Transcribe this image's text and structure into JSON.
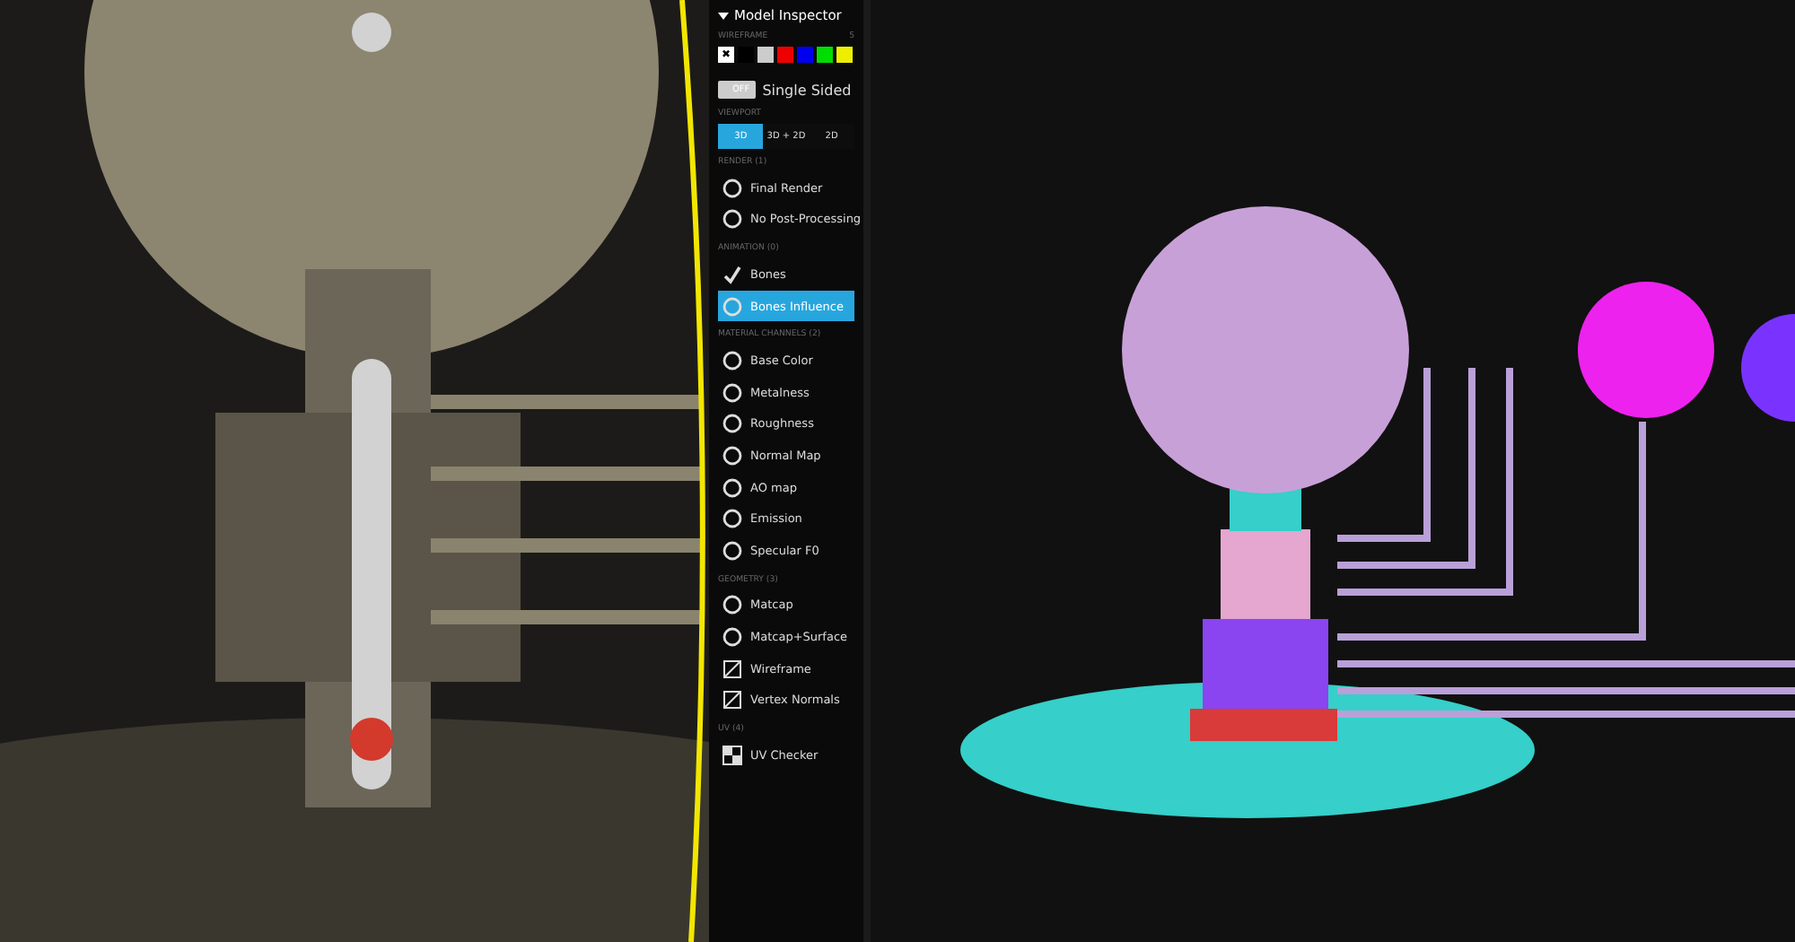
{
  "panel": {
    "title": "Model Inspector",
    "expanded": true
  },
  "wireframe": {
    "heading": "WIREFRAME",
    "count": "5",
    "swatches": [
      {
        "kind": "none",
        "label": "✖"
      },
      {
        "kind": "color",
        "color": "#000000"
      },
      {
        "kind": "color",
        "color": "#cccccc"
      },
      {
        "kind": "color",
        "color": "#ee0000"
      },
      {
        "kind": "color",
        "color": "#0000ee"
      },
      {
        "kind": "color",
        "color": "#00dd00"
      },
      {
        "kind": "color",
        "color": "#eeee00"
      }
    ]
  },
  "single_sided": {
    "state": "OFF",
    "on": false,
    "label": "Single Sided"
  },
  "viewport": {
    "heading": "VIEWPORT",
    "tabs": [
      {
        "label": "3D",
        "selected": true
      },
      {
        "label": "3D + 2D",
        "selected": false
      },
      {
        "label": "2D",
        "selected": false
      }
    ]
  },
  "sections": [
    {
      "heading": "RENDER (1)",
      "items": [
        {
          "label": "Final Render",
          "selected": false
        },
        {
          "label": "No Post-Processing",
          "selected": false
        }
      ]
    },
    {
      "heading": "ANIMATION (0)",
      "items": [
        {
          "label": "Bones",
          "selected": false
        },
        {
          "label": "Bones Influence",
          "selected": true
        }
      ]
    },
    {
      "heading": "MATERIAL CHANNELS (2)",
      "items": [
        {
          "label": "Base Color",
          "selected": false
        },
        {
          "label": "Metalness",
          "selected": false
        },
        {
          "label": "Roughness",
          "selected": false
        },
        {
          "label": "Normal Map",
          "selected": false
        },
        {
          "label": "AO map",
          "selected": false
        },
        {
          "label": "Emission",
          "selected": false
        },
        {
          "label": "Specular F0",
          "selected": false
        }
      ]
    },
    {
      "heading": "GEOMETRY (3)",
      "items": [
        {
          "label": "Matcap",
          "selected": false
        },
        {
          "label": "Matcap+Surface",
          "selected": false
        },
        {
          "label": "Wireframe",
          "selected": false
        },
        {
          "label": "Vertex Normals",
          "selected": false
        }
      ]
    },
    {
      "heading": "UV (4)",
      "items": [
        {
          "label": "UV Checker",
          "selected": false
        }
      ]
    }
  ]
}
